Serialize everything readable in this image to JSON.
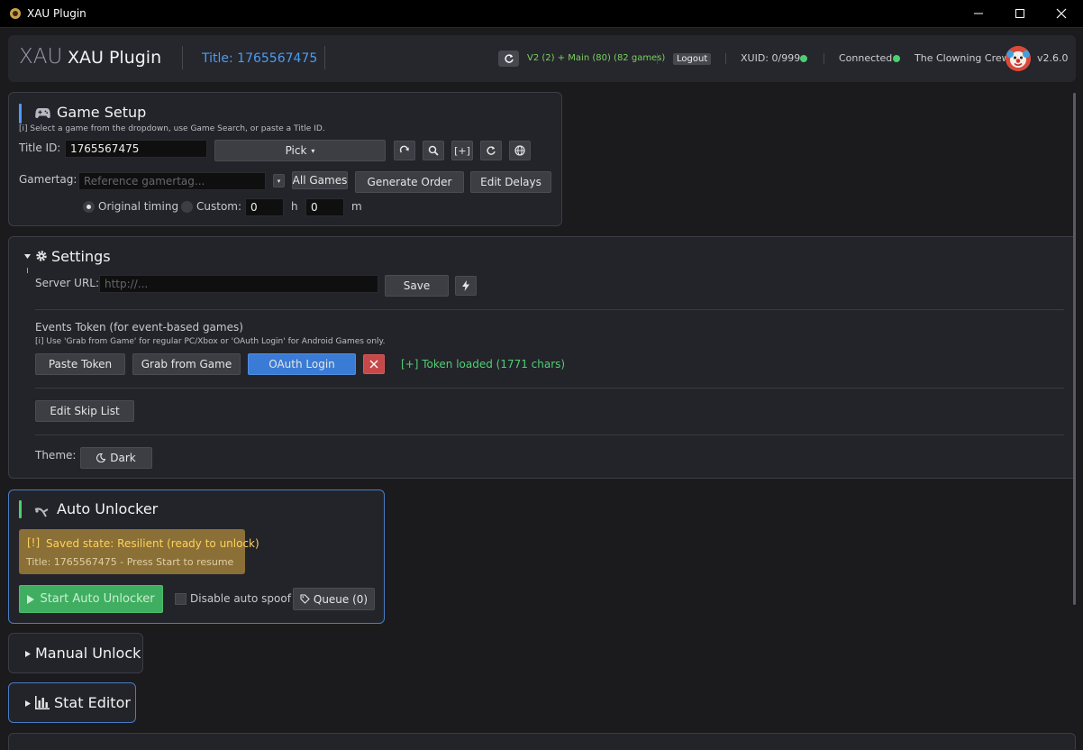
{
  "window": {
    "title": "XAU Plugin"
  },
  "header": {
    "logo_text": "XAU",
    "app_name": "XAU Plugin",
    "title_label": "Title: 1765567475",
    "games_status": "V2 (2) + Main (80) (82 games)",
    "logout_label": "Logout",
    "xuid_status": "XUID: 0/999",
    "connection_status": "Connected",
    "user_name": "The Clowning Crew",
    "version": "v2.6.0",
    "status_color": "#4bd06f",
    "accent_color": "#4b9cf2"
  },
  "game_setup": {
    "title": "Game Setup",
    "hint": "[i] Select a game from the dropdown, use Game Search, or paste a Title ID.",
    "title_id_label": "Title ID:",
    "title_id_value": "1765567475",
    "pick_label": "Pick",
    "pick_arrow": "▾",
    "add_label": "[+]",
    "gamertag_label": "Gamertag:",
    "gamertag_placeholder": "Reference gamertag...",
    "all_games_label": "All Games",
    "generate_order_label": "Generate Order",
    "edit_delays_label": "Edit Delays",
    "original_timing_label": "Original timing",
    "custom_label": "Custom:",
    "hours_value": "0",
    "hours_unit": "h",
    "minutes_value": "0",
    "minutes_unit": "m"
  },
  "settings": {
    "title": "Settings",
    "server_url_label": "Server URL:",
    "server_url_placeholder": "http://...",
    "save_label": "Save",
    "events_token_label": "Events Token (for event-based games)",
    "events_token_hint": "[i] Use 'Grab from Game' for regular PC/Xbox or 'OAuth Login' for Android Games only.",
    "paste_token_label": "Paste Token",
    "grab_from_game_label": "Grab from Game",
    "oauth_login_label": "OAuth Login",
    "token_status": "[+] Token loaded (1771 chars)",
    "edit_skip_list_label": "Edit Skip List",
    "theme_label": "Theme:",
    "theme_value": "Dark"
  },
  "auto_unlocker": {
    "title": "Auto Unlocker",
    "alert_icon": "[!]",
    "alert_title": "Saved state: Resilient (ready to unlock)",
    "alert_subtitle": "Title: 1765567475 - Press Start to resume",
    "start_label": "Start Auto Unlocker",
    "disable_spoof_label": "Disable auto spoof",
    "queue_label": "Queue (0)"
  },
  "manual_unlock": {
    "title": "Manual Unlock"
  },
  "stat_editor": {
    "title": "Stat Editor"
  }
}
